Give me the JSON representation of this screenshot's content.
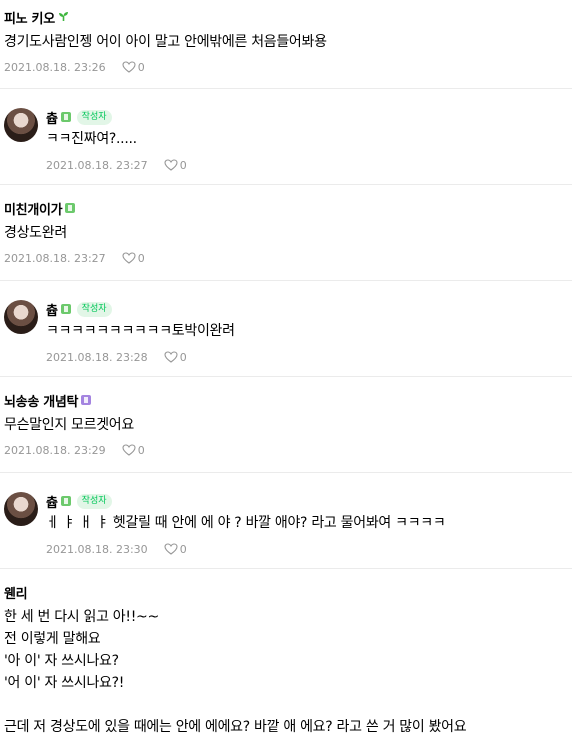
{
  "comments": [
    {
      "nickname": "피노 키오",
      "badge": "sprout",
      "text": "경기도사람인젱 어이 아이 말고 안에밖에른 처음들어봐용",
      "date": "2021.08.18. 23:26",
      "likes": "0",
      "is_reply": false
    },
    {
      "nickname": "츕",
      "badge": "green-grade",
      "author_label": "작성자",
      "text": "ㅋㅋ진짜여?.....",
      "date": "2021.08.18. 23:27",
      "likes": "0",
      "is_reply": true
    },
    {
      "nickname": "미친개이가",
      "badge": "green-grade",
      "text": "경상도완려",
      "date": "2021.08.18. 23:27",
      "likes": "0",
      "is_reply": false
    },
    {
      "nickname": "츕",
      "badge": "green-grade",
      "author_label": "작성자",
      "text": "ㅋㅋㅋㅋㅋㅋㅋㅋㅋㅋ토박이완려",
      "date": "2021.08.18. 23:28",
      "likes": "0",
      "is_reply": true
    },
    {
      "nickname": "뇌송송 개념탁",
      "badge": "purple-grade",
      "text": "무슨말인지 모르겟어요",
      "date": "2021.08.18. 23:29",
      "likes": "0",
      "is_reply": false
    },
    {
      "nickname": "츕",
      "badge": "green-grade",
      "author_label": "작성자",
      "text": "ㅔ ㅑ ㅐ ㅑ 헷갈릴 때 안에 에 야 ? 바깔 애야? 라고 물어봐여 ㅋㅋㅋㅋ",
      "date": "2021.08.18. 23:30",
      "likes": "0",
      "is_reply": true
    },
    {
      "nickname": "웬리",
      "badge": "none",
      "lines": [
        "한 세 번 다시 읽고 아!!~~",
        "전 이렇게 말해요",
        "'아 이' 자 쓰시나요?",
        "'어 이' 자 쓰시나요?!",
        "",
        "근데 저 경상도에 있을 때에는 안에 에에요? 바깥 애 에요? 라고 쓴 거 많이 봤어요"
      ],
      "is_reply": false
    }
  ],
  "colors": {
    "author_badge_text": "#03c75a",
    "author_badge_bg": "#e2f6e7",
    "meta_text": "#979797",
    "divider": "#ebebeb"
  },
  "icons": {
    "like": "heart-outline-icon",
    "level_sprout": "sprout-icon",
    "level_green": "green-grade-icon",
    "level_purple": "purple-grade-icon"
  }
}
